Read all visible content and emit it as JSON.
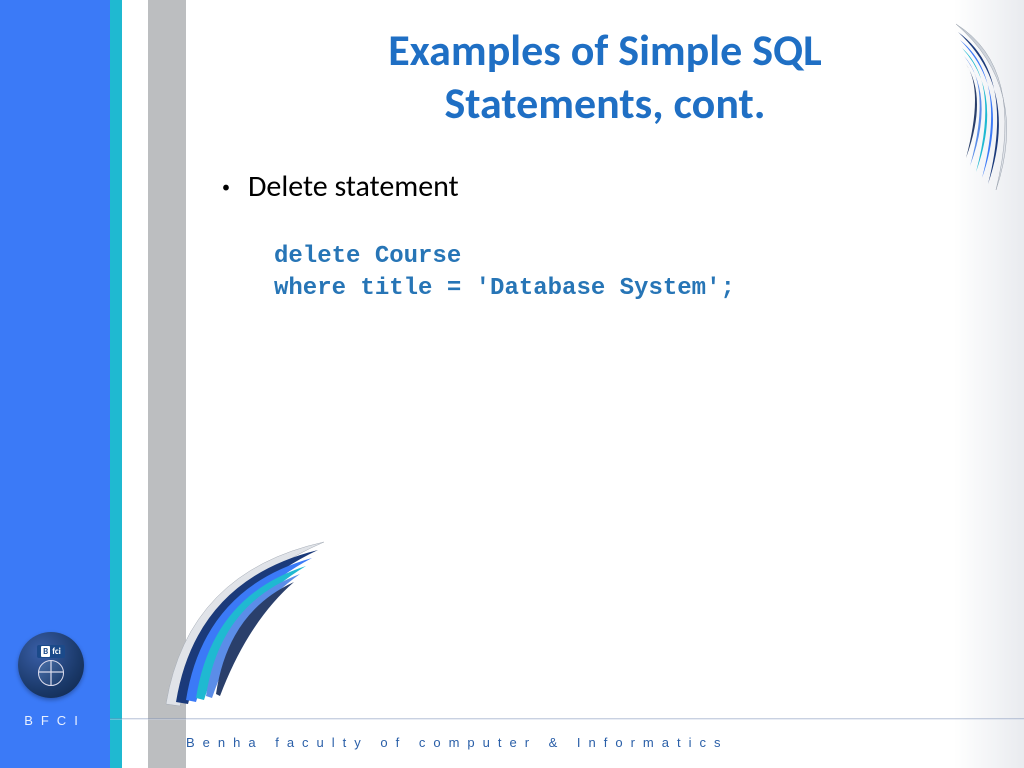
{
  "slide": {
    "title_line1": "Examples of Simple SQL",
    "title_line2": "Statements, cont.",
    "bullet": "Delete statement",
    "code": "delete Course\nwhere title = 'Database System';"
  },
  "sidebar": {
    "acronym": "BFCI",
    "logo_top": "fci"
  },
  "footer": {
    "text": "Benha faculty of computer & Informatics"
  }
}
